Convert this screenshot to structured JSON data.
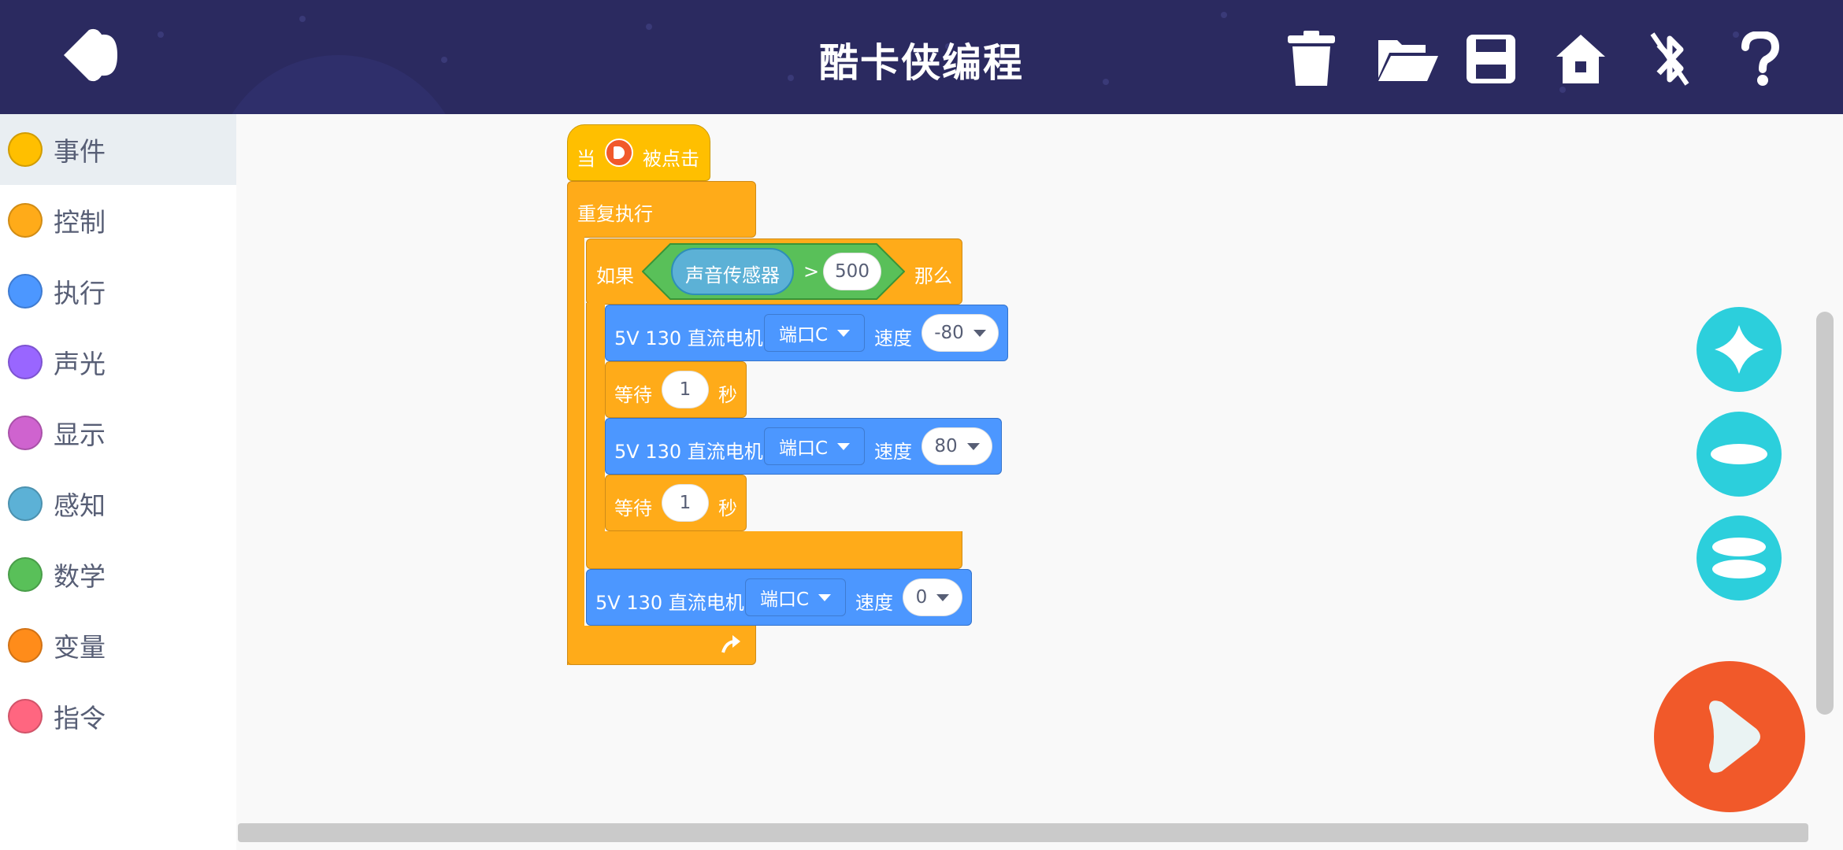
{
  "header": {
    "title": "酷卡侠编程",
    "icons": [
      "back-icon",
      "trash-icon",
      "folder-open-icon",
      "save-icon",
      "home-icon",
      "bluetooth-off-icon",
      "help-icon"
    ]
  },
  "sidebar": {
    "items": [
      {
        "label": "事件",
        "color": "#ffbf00"
      },
      {
        "label": "控制",
        "color": "#ffab19"
      },
      {
        "label": "执行",
        "color": "#4c97ff"
      },
      {
        "label": "声光",
        "color": "#9966ff"
      },
      {
        "label": "显示",
        "color": "#cf63cf"
      },
      {
        "label": "感知",
        "color": "#5cb1d6"
      },
      {
        "label": "数学",
        "color": "#59c059"
      },
      {
        "label": "变量",
        "color": "#ff8c1a"
      },
      {
        "label": "指令",
        "color": "#ff6680"
      }
    ]
  },
  "script": {
    "hat": {
      "prefix": "当",
      "suffix": "被点击"
    },
    "forever": {
      "label": "重复执行"
    },
    "if": {
      "label": "如果",
      "then": "那么",
      "sensor": "声音传感器",
      "op": ">",
      "value": "500"
    },
    "motor1": {
      "label": "5V 130 直流电机",
      "port": "端口C",
      "speed_label": "速度",
      "speed": "-80"
    },
    "wait1": {
      "label": "等待",
      "value": "1",
      "unit": "秒"
    },
    "motor2": {
      "label": "5V 130 直流电机",
      "port": "端口C",
      "speed_label": "速度",
      "speed": "80"
    },
    "wait2": {
      "label": "等待",
      "value": "1",
      "unit": "秒"
    },
    "motor3": {
      "label": "5V 130 直流电机",
      "port": "端口C",
      "speed_label": "速度",
      "speed": "0"
    }
  },
  "colors": {
    "header": "#2b2a60",
    "event": "#ffbf00",
    "control": "#ffab19",
    "motion": "#4c97ff",
    "sensing": "#5cb1d6",
    "operator": "#59c059",
    "zoom": "#2ccfdc",
    "run": "#f1592a"
  }
}
